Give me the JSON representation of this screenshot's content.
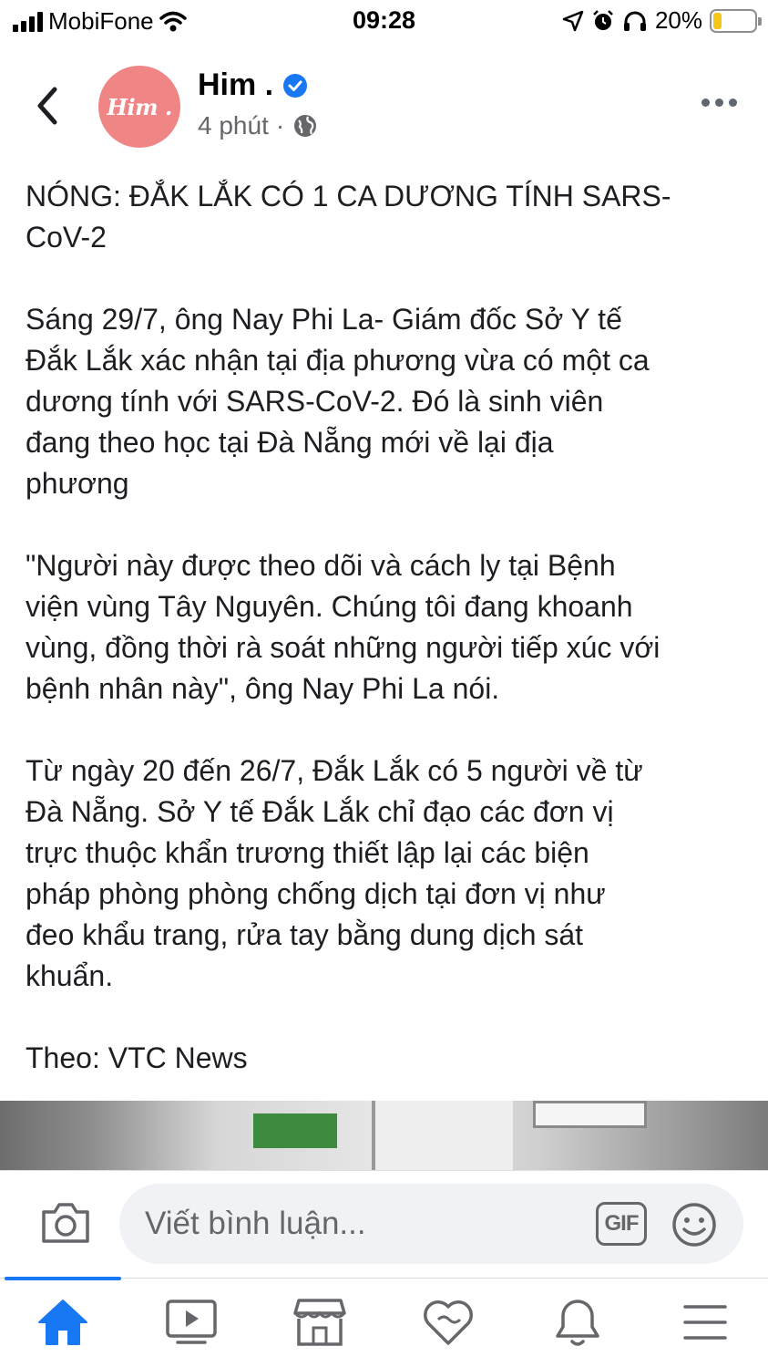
{
  "status_bar": {
    "carrier": "MobiFone",
    "time": "09:28",
    "battery_percent": "20%",
    "battery_level": 0.2,
    "battery_color": "#f5c518",
    "icons": [
      "signal-icon",
      "wifi-icon",
      "location-icon",
      "alarm-icon",
      "headphones-icon",
      "battery-icon"
    ]
  },
  "post": {
    "author": "Him .",
    "avatar_text": "Him .",
    "verified": true,
    "time_ago": "4 phút",
    "separator": "·",
    "audience_icon": "globe-icon",
    "paragraphs": [
      "NÓNG: ĐẮK LẮK CÓ 1 CA DƯƠNG TÍNH SARS-\nCoV-2",
      "Sáng 29/7, ông Nay Phi La- Giám đốc Sở Y tế\nĐắk Lắk xác nhận tại địa phương vừa có một ca\ndương tính với SARS-CoV-2. Đó là sinh viên\nđang theo học tại Đà Nẵng mới về lại địa\nphương",
      "\"Người này được theo dõi và cách ly tại Bệnh\nviện vùng Tây Nguyên. Chúng tôi đang khoanh\nvùng, đồng thời rà soát những người tiếp xúc với\nbệnh nhân này\", ông Nay Phi La nói.",
      "Từ ngày 20 đến 26/7, Đắk Lắk có 5 người về từ\nĐà Nẵng. Sở Y tế Đắk Lắk chỉ đạo các đơn vị\ntrực thuộc khẩn trương thiết lập lại các biện\npháp phòng phòng chống dịch tại đơn vị như\nđeo khẩu trang, rửa tay bằng dung dịch sát\nkhuẩn.",
      "Theo: VTC News"
    ]
  },
  "comment_bar": {
    "placeholder": "Viết bình luận...",
    "gif_label": "GIF"
  },
  "tab_bar": {
    "active_color": "#1877f2",
    "inactive_color": "#65676b",
    "tabs": [
      "home-icon",
      "watch-icon",
      "marketplace-icon",
      "dating-icon",
      "notifications-icon",
      "menu-icon"
    ]
  },
  "colors": {
    "avatar_bg": "#f08585",
    "verified": "#1877f2",
    "meta_text": "#65676b"
  }
}
